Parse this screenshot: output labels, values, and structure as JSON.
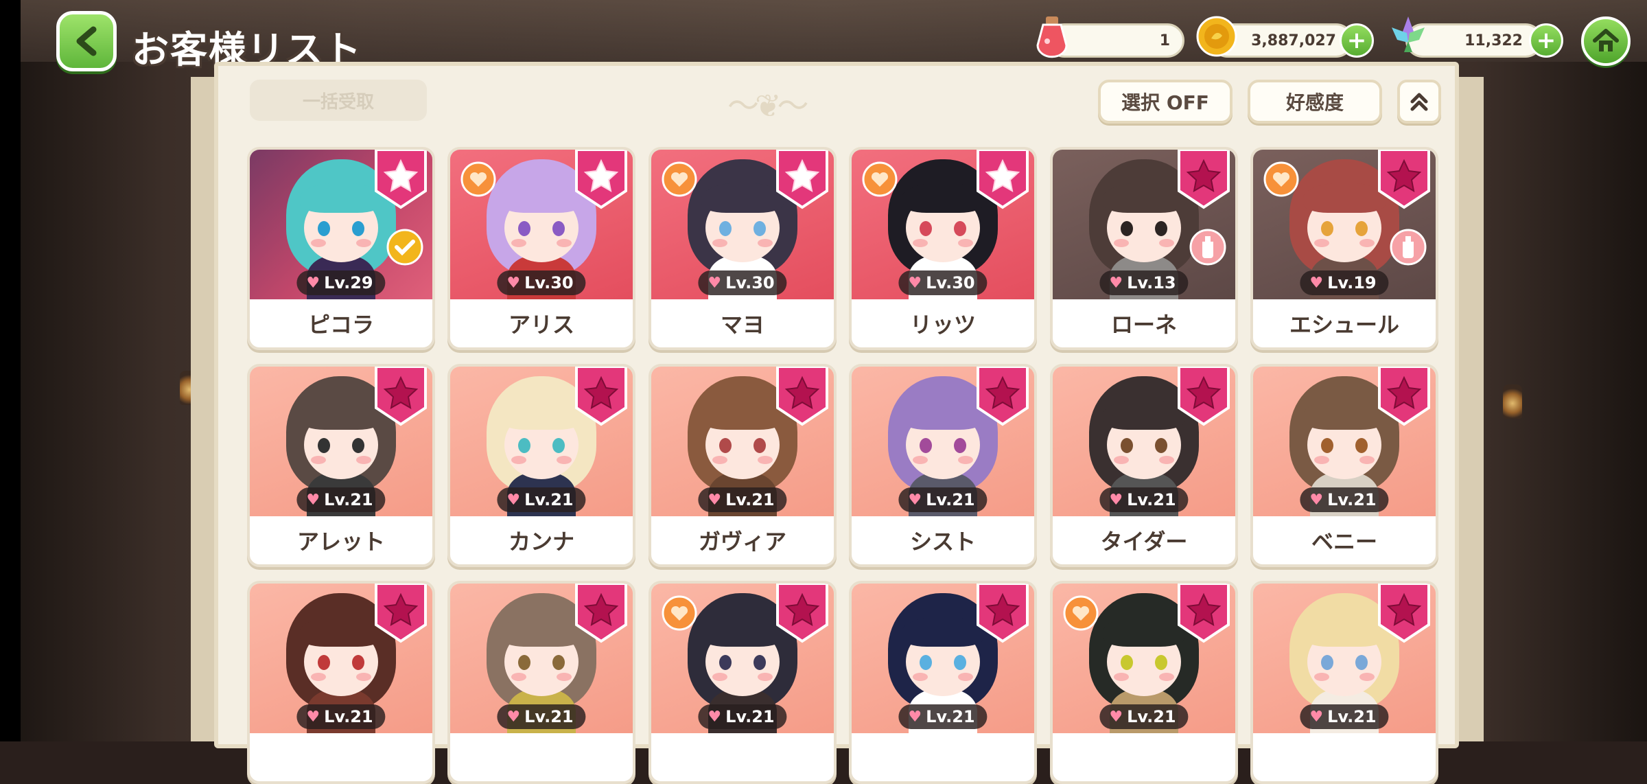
{
  "header": {
    "title": "お客様リスト"
  },
  "resources": {
    "potion": "1",
    "gold": "3,887,027",
    "gem": "11,322"
  },
  "toolbar": {
    "bulk_receive": "一括受取",
    "select_toggle": "選択 OFF",
    "sort": "好感度"
  },
  "colors": {
    "accent_green": "#5fb63b",
    "badge_pink": "#e0457f",
    "card_bg_red": "#e85c6c",
    "card_bg_salmon": "#f6a594",
    "card_bg_gray": "#6c5452"
  },
  "customers": [
    {
      "name": "ピコラ",
      "level": "Lv.29",
      "favorite": false,
      "star": "light",
      "bg": "purple",
      "side_icon": "coin-icon",
      "hair": "#4fc6c6",
      "eye": "#2a9ed0",
      "outfit": "#3a2a55"
    },
    {
      "name": "アリス",
      "level": "Lv.30",
      "favorite": true,
      "star": "light",
      "bg": "red",
      "side_icon": "",
      "hair": "#c7a6e8",
      "eye": "#8a5bc4",
      "outfit": "#c93a3a"
    },
    {
      "name": "マヨ",
      "level": "Lv.30",
      "favorite": true,
      "star": "light",
      "bg": "red",
      "side_icon": "",
      "hair": "#3b3447",
      "eye": "#6fb0e0",
      "outfit": "#ffffff"
    },
    {
      "name": "リッツ",
      "level": "Lv.30",
      "favorite": true,
      "star": "light",
      "bg": "red",
      "side_icon": "",
      "hair": "#1e1c24",
      "eye": "#d64a5a",
      "outfit": "#ffffff"
    },
    {
      "name": "ローネ",
      "level": "Lv.13",
      "favorite": false,
      "star": "dark",
      "bg": "gray",
      "side_icon": "bottle-icon",
      "hair": "#4d3c38",
      "eye": "#2c2422",
      "outfit": "#8d8a88"
    },
    {
      "name": "エシュール",
      "level": "Lv.19",
      "favorite": true,
      "star": "dark",
      "bg": "gray",
      "side_icon": "bottle-icon",
      "hair": "#a84b45",
      "eye": "#e6a33a",
      "outfit": "#6d5048"
    },
    {
      "name": "アレット",
      "level": "Lv.21",
      "favorite": false,
      "star": "dark",
      "bg": "salmon",
      "side_icon": "",
      "hair": "#5a4a44",
      "eye": "#333333",
      "outfit": "#3a3a3a"
    },
    {
      "name": "カンナ",
      "level": "Lv.21",
      "favorite": false,
      "star": "dark",
      "bg": "salmon",
      "side_icon": "",
      "hair": "#f4e6c2",
      "eye": "#4cbcc2",
      "outfit": "#2d3350"
    },
    {
      "name": "ガヴィア",
      "level": "Lv.21",
      "favorite": false,
      "star": "dark",
      "bg": "salmon",
      "side_icon": "",
      "hair": "#8a5a3e",
      "eye": "#b04a4a",
      "outfit": "#6a4530"
    },
    {
      "name": "シスト",
      "level": "Lv.21",
      "favorite": false,
      "star": "dark",
      "bg": "salmon",
      "side_icon": "",
      "hair": "#9a7cc4",
      "eye": "#a24b9a",
      "outfit": "#5a5a6a"
    },
    {
      "name": "タイダー",
      "level": "Lv.21",
      "favorite": false,
      "star": "dark",
      "bg": "salmon",
      "side_icon": "",
      "hair": "#3a3030",
      "eye": "#7a5030",
      "outfit": "#555555"
    },
    {
      "name": "ベニー",
      "level": "Lv.21",
      "favorite": false,
      "star": "dark",
      "bg": "salmon",
      "side_icon": "",
      "hair": "#7a5a44",
      "eye": "#a0602e",
      "outfit": "#d8d0c4"
    },
    {
      "name": "",
      "level": "Lv.21",
      "favorite": false,
      "star": "dark",
      "bg": "salmon",
      "side_icon": "",
      "hair": "#5a2e26",
      "eye": "#c03a3a",
      "outfit": "#7a3a2e"
    },
    {
      "name": "",
      "level": "Lv.21",
      "favorite": false,
      "star": "dark",
      "bg": "salmon",
      "side_icon": "",
      "hair": "#8a7262",
      "eye": "#8a6a3a",
      "outfit": "#c9b24a"
    },
    {
      "name": "",
      "level": "Lv.21",
      "favorite": true,
      "star": "dark",
      "bg": "salmon",
      "side_icon": "",
      "hair": "#2e2c3a",
      "eye": "#3c3a5a",
      "outfit": "#3a2e2e"
    },
    {
      "name": "",
      "level": "Lv.21",
      "favorite": false,
      "star": "dark",
      "bg": "salmon",
      "side_icon": "",
      "hair": "#1e2448",
      "eye": "#5ab0e0",
      "outfit": "#ffffff"
    },
    {
      "name": "",
      "level": "Lv.21",
      "favorite": true,
      "star": "dark",
      "bg": "salmon",
      "side_icon": "",
      "hair": "#262a26",
      "eye": "#c8c82e",
      "outfit": "#b99a6a"
    },
    {
      "name": "",
      "level": "Lv.21",
      "favorite": false,
      "star": "dark",
      "bg": "salmon",
      "side_icon": "",
      "hair": "#f1dca4",
      "eye": "#7aa8d8",
      "outfit": "#f4ece2"
    }
  ]
}
